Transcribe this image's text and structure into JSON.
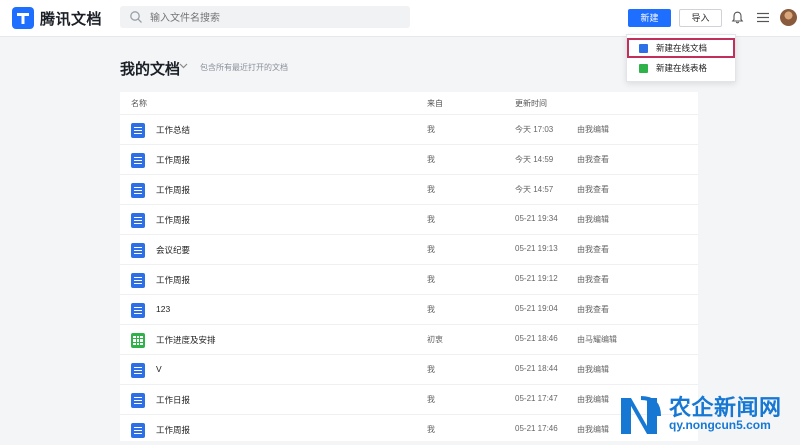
{
  "app": {
    "brand": "腾讯文档",
    "search_placeholder": "输入文件名搜索",
    "new_button": "新建",
    "import_button": "导入"
  },
  "dropdown": {
    "items": [
      {
        "label": "新建在线文档",
        "icon": "doc-icon",
        "color": "#2d6fe6"
      },
      {
        "label": "新建在线表格",
        "icon": "sheet-icon",
        "color": "#2fb349"
      }
    ]
  },
  "heading": {
    "title": "我的文档",
    "subtitle": "包含所有最近打开的文档"
  },
  "table": {
    "columns": [
      "名称",
      "来自",
      "更新时间"
    ],
    "rows": [
      {
        "name": "工作总结",
        "type": "doc",
        "from": "我",
        "time": "今天 17:03",
        "action": "由我编辑"
      },
      {
        "name": "工作周报",
        "type": "doc",
        "from": "我",
        "time": "今天 14:59",
        "action": "由我查看"
      },
      {
        "name": "工作周报",
        "type": "doc",
        "from": "我",
        "time": "今天 14:57",
        "action": "由我查看"
      },
      {
        "name": "工作周报",
        "type": "doc",
        "from": "我",
        "time": "05-21 19:34",
        "action": "由我编辑"
      },
      {
        "name": "会议纪要",
        "type": "doc",
        "from": "我",
        "time": "05-21 19:13",
        "action": "由我查看"
      },
      {
        "name": "工作周报",
        "type": "doc",
        "from": "我",
        "time": "05-21 19:12",
        "action": "由我查看"
      },
      {
        "name": "123",
        "type": "doc",
        "from": "我",
        "time": "05-21 19:04",
        "action": "由我查看"
      },
      {
        "name": "工作进度及安排",
        "type": "sheet",
        "from": "初衷",
        "time": "05-21 18:46",
        "action": "由马耀编辑"
      },
      {
        "name": "V",
        "type": "doc",
        "from": "我",
        "time": "05-21 18:44",
        "action": "由我编辑"
      },
      {
        "name": "工作日报",
        "type": "doc",
        "from": "我",
        "time": "05-21 17:47",
        "action": "由我编辑"
      },
      {
        "name": "工作周报",
        "type": "doc",
        "from": "我",
        "time": "05-21 17:46",
        "action": "由我编辑"
      }
    ]
  },
  "watermark": {
    "text": "农企新闻网",
    "url": "qy.nongcun5.com"
  },
  "colors": {
    "accent": "#1e6fff",
    "doc": "#2d6fe6",
    "sheet": "#2fb349",
    "highlight": "#c0305a"
  }
}
